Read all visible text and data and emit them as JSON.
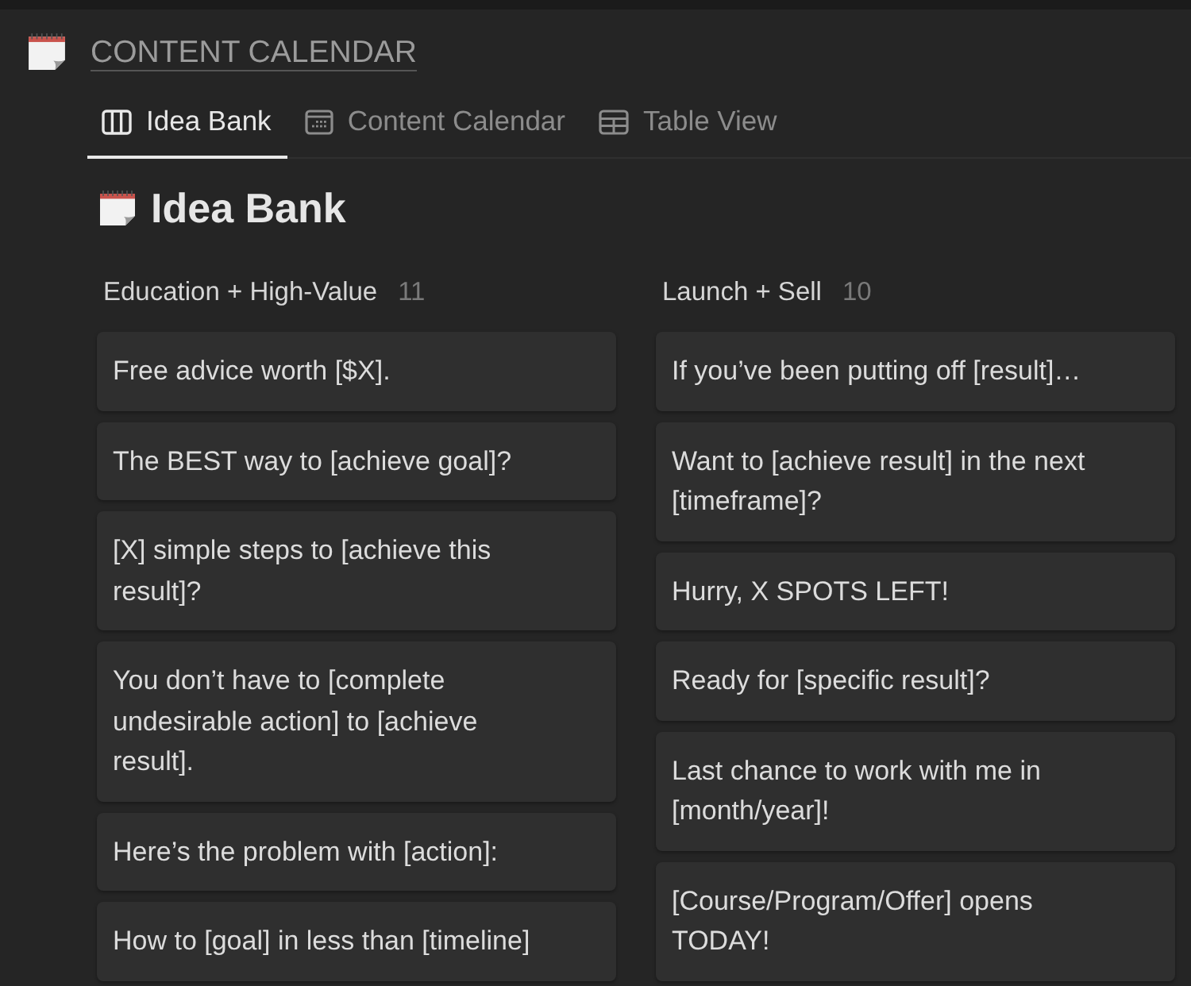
{
  "page": {
    "title": "CONTENT CALENDAR"
  },
  "tabs": [
    {
      "label": "Idea Bank",
      "kind": "board",
      "selected": true
    },
    {
      "label": "Content Calendar",
      "kind": "calendar",
      "selected": false
    },
    {
      "label": "Table View",
      "kind": "table",
      "selected": false
    }
  ],
  "view": {
    "title": "Idea Bank"
  },
  "board": {
    "columns": [
      {
        "name": "Education + High-Value",
        "count": "11",
        "cards": [
          "Free advice worth [$X].",
          "The BEST way to [achieve goal]?",
          "[X] simple steps to [achieve this result]?",
          "You don’t have to [complete undesirable action] to [achieve result].",
          "Here’s the problem with [action]:",
          "How to [goal] in less than [timeline]"
        ]
      },
      {
        "name": "Launch + Sell",
        "count": "10",
        "cards": [
          "If you’ve been putting off [result]…",
          "Want to [achieve result] in the next [timeframe]?",
          "Hurry, X SPOTS LEFT!",
          "Ready for [specific result]?",
          "Last chance to work with me in [month/year]!",
          "[Course/Program/Offer] opens TODAY!"
        ]
      }
    ]
  }
}
